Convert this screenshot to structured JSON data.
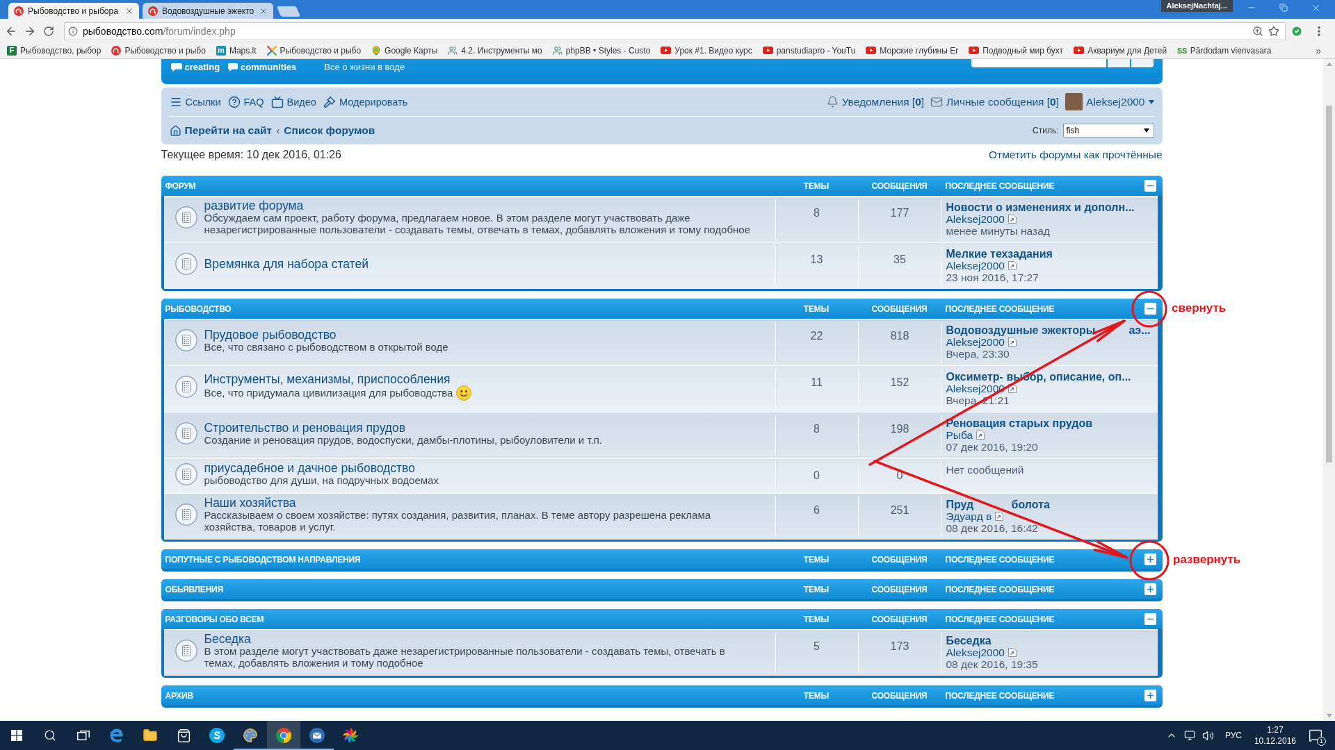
{
  "browser": {
    "tabs": [
      {
        "title": "Рыбоводство и рыбора",
        "selected": true
      },
      {
        "title": "Водовоздушные эжекто",
        "selected": false
      }
    ],
    "profile": "AleksejNachtaj...",
    "address": {
      "host": "рыбоводство.com",
      "path": "/forum/index.php"
    },
    "bookmarks": [
      {
        "label": "Рыбоводство, рыбор",
        "kind": "letter",
        "badge": "F",
        "color": "#1e7a3c"
      },
      {
        "label": "Рыбоводство и рыбо",
        "kind": "forum"
      },
      {
        "label": "Maps.lt",
        "kind": "letter",
        "badge": "m",
        "color": "#1a8fb3"
      },
      {
        "label": "Рыбоводство и рыбо",
        "kind": "cross"
      },
      {
        "label": "Google Карты",
        "kind": "pin"
      },
      {
        "label": "4.2. Инструменты мо",
        "kind": "people"
      },
      {
        "label": "phpBB • Styles - Custo",
        "kind": "people"
      },
      {
        "label": "Урок #1. Видео курс",
        "kind": "video"
      },
      {
        "label": "panstudiapro - YouTu",
        "kind": "video"
      },
      {
        "label": "Морские глубины Er",
        "kind": "video"
      },
      {
        "label": "Подводный мир бухт",
        "kind": "video"
      },
      {
        "label": "Аквариум для Детей",
        "kind": "video"
      },
      {
        "label": "Pārdodam vienvasara",
        "kind": "text-logo",
        "badge": "SS",
        "color": "#2e8b2e"
      }
    ],
    "overflow": "»"
  },
  "banner": {
    "logo_words": [
      "creating",
      "communities"
    ],
    "tagline": "Все о жизни в воде"
  },
  "nav": {
    "links": [
      {
        "label": "Ссылки",
        "kind": "menu"
      },
      {
        "label": "FAQ",
        "kind": "help"
      },
      {
        "label": "Видео",
        "kind": "video"
      },
      {
        "label": "Модерировать",
        "kind": "moderate"
      }
    ],
    "notifications": "Уведомления [**0**]",
    "messages": "Личные сообщения [**0**]",
    "user": "Aleksej2000",
    "breadcrumbs": [
      "Перейти на сайт",
      "Список форумов"
    ],
    "separator": "‹",
    "style_label": "Стиль:",
    "style_value": "fish"
  },
  "time_info": "Текущее время: 10 дек 2016, 01:26",
  "mark_read": "Отметить форумы как прочтённые",
  "sections": [
    {
      "title": "ФОРУМ",
      "columns": [
        "ТЕМЫ",
        "СООБЩЕНИЯ",
        "ПОСЛЕДНЕЕ СООБЩЕНИЕ"
      ],
      "expanded": true,
      "forums": [
        {
          "title": "развитие форума",
          "description": "Обсуждаем сам проект, работу форума, предлагаем новое. В этом разделе могут участвовать даже незарегистрированные пользователи - создавать темы, отвечать в темах, добавлять вложения и тому подобное",
          "topics": "8",
          "posts": "177",
          "last_post": {
            "kind": "post",
            "title": "Новости о изменениях и дополн...",
            "author": "Aleksej2000",
            "time": "менее минуты назад"
          }
        },
        {
          "title": "Времянка для набора статей",
          "topics": "13",
          "posts": "35",
          "last_post": {
            "kind": "post",
            "title": "Мелкие техзадания",
            "author": "Aleksej2000",
            "time": "23 ноя 2016, 17:27"
          }
        }
      ]
    },
    {
      "title": "РЫБОВОДСТВО",
      "columns": [
        "ТЕМЫ",
        "СООБЩЕНИЯ",
        "ПОСЛЕДНЕЕ СООБЩЕНИЕ"
      ],
      "expanded": true,
      "forums": [
        {
          "title": "Прудовое рыбоводство",
          "description": "Все, что связано с рыбоводством в открытой воде",
          "topics": "22",
          "posts": "818",
          "last_post": {
            "kind": "post",
            "title": [
              "Водовоздушные эжекторы",
              "аэ..."
            ],
            "author": "Aleksej2000",
            "time": "Вчера, 23:30"
          }
        },
        {
          "title": "Инструменты, механизмы, приспособления",
          "description": "Все, что придумала цивилизация для рыбоводства",
          "emoticon": true,
          "topics": "11",
          "posts": "152",
          "last_post": {
            "kind": "post",
            "title": "Оксиметр- выбор, описание, оп...",
            "author": "Aleksej2000",
            "time": "Вчера, 21:21"
          }
        },
        {
          "title": "Строительство и реновация прудов",
          "description": "Создание и реновация прудов, водоспуски, дамбы-плотины, рыбоуловители и т.п.",
          "topics": "8",
          "posts": "198",
          "last_post": {
            "kind": "post",
            "title": "Реновация старых прудов",
            "author": "Рыба",
            "time": "07 дек 2016, 19:20"
          }
        },
        {
          "title": "приусадебное и дачное рыбоводство",
          "description": "рыбоводство для души, на подручных водоемах",
          "topics": "0",
          "posts": "0",
          "last_post": {
            "kind": "none",
            "text": "Нет сообщений"
          }
        },
        {
          "title": "Наши хозяйства",
          "description": "Рассказываем о своем хозяйстве: путях создания, развития, планах. В теме автору разрешена реклама хозяйства, товаров и услуг.",
          "topics": "6",
          "posts": "251",
          "last_post": {
            "kind": "post",
            "title": [
              "Пруд",
              "болота"
            ],
            "author": "Эдуард в",
            "time": "08 дек 2016, 16:42"
          }
        }
      ]
    },
    {
      "title": "ПОПУТНЫЕ С РЫБОВОДСТВОМ НАПРАВЛЕНИЯ",
      "columns": [
        "ТЕМЫ",
        "СООБЩЕНИЯ",
        "ПОСЛЕДНЕЕ СООБЩЕНИЕ"
      ],
      "expanded": false
    },
    {
      "title": "ОБЬЯВЛЕНИЯ",
      "columns": [
        "ТЕМЫ",
        "СООБЩЕНИЯ",
        "ПОСЛЕДНЕЕ СООБЩЕНИЕ"
      ],
      "expanded": false
    },
    {
      "title": "РАЗГОВОРЫ ОБО ВСЕМ",
      "columns": [
        "ТЕМЫ",
        "СООБЩЕНИЯ",
        "ПОСЛЕДНЕЕ СООБЩЕНИЕ"
      ],
      "expanded": true,
      "forums": [
        {
          "title": "Беседка",
          "description": "В этом разделе могут участвовать даже незарегистрированные пользователи - создавать темы, отвечать в темах, добавлять вложения и тому подобное",
          "topics": "5",
          "posts": "173",
          "last_post": {
            "kind": "post",
            "title": "Беседка",
            "author": "Aleksej2000",
            "time": "08 дек 2016, 19:35"
          }
        }
      ]
    },
    {
      "title": "АРХИВ",
      "columns": [
        "ТЕМЫ",
        "СООБЩЕНИЯ",
        "ПОСЛЕДНЕЕ СООБЩЕНИЕ"
      ],
      "expanded": false
    }
  ],
  "annotations": [
    {
      "label": "свернуть"
    },
    {
      "label": "развернуть"
    }
  ],
  "taskbar": {
    "apps": [
      {
        "kind": "start",
        "running": false,
        "selected": false
      },
      {
        "kind": "search",
        "running": false,
        "selected": false
      },
      {
        "kind": "task-view",
        "running": false,
        "selected": false
      },
      {
        "kind": "browser-e",
        "running": false,
        "selected": false
      },
      {
        "kind": "folder",
        "running": false,
        "selected": false
      },
      {
        "kind": "bag",
        "running": false,
        "selected": false
      },
      {
        "kind": "chat",
        "running": false,
        "selected": false
      },
      {
        "kind": "palette",
        "running": true,
        "selected": false
      },
      {
        "kind": "browser-circle",
        "running": true,
        "selected": true
      },
      {
        "kind": "mail",
        "running": true,
        "selected": false
      },
      {
        "kind": "pinwheel",
        "running": false,
        "selected": false
      }
    ],
    "language": "РУС",
    "time": "1:27",
    "date": "10.12.2016",
    "notifications": "1"
  }
}
